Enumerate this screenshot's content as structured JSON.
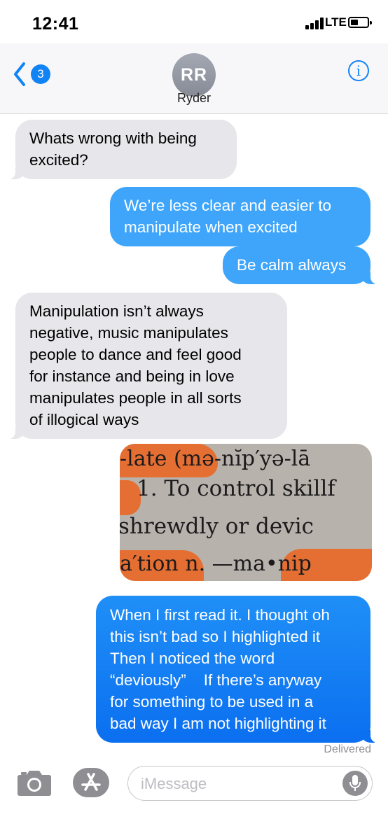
{
  "status_bar": {
    "time": "12:41",
    "network": "LTE"
  },
  "header": {
    "back_count": "3",
    "avatar_initials": "RR",
    "contact_name": "Ryder",
    "info_glyph": "i"
  },
  "messages": [
    {
      "direction": "incoming",
      "text_lines": [
        "Whats wrong with being",
        "excited?"
      ]
    },
    {
      "direction": "outgoing",
      "text_lines": [
        "We’re less clear and easier to",
        "manipulate when excited"
      ]
    },
    {
      "direction": "outgoing",
      "text_lines": [
        "Be calm always"
      ]
    },
    {
      "direction": "incoming",
      "text_lines": [
        "Manipulation isn’t always",
        "negative, music manipulates",
        "people to dance and feel good",
        "for instance and being in love",
        "manipulates people in all sorts",
        "of illogical ways"
      ]
    },
    {
      "direction": "outgoing",
      "type": "image",
      "image_text_lines": [
        "-late (mə-nĭp′yə-lā",
        "1. To control skillf",
        "shrewdly or devic",
        "a′tion n. —ma•nip"
      ]
    },
    {
      "direction": "outgoing",
      "text_lines": [
        "When I first read it. I thought oh",
        "this isn’t bad so I highlighted it",
        "Then I noticed the word",
        "“deviously”    If there’s anyway",
        "for something to be used in a",
        "bad way I am not highlighting it"
      ]
    }
  ],
  "delivered_label": "Delivered",
  "input_bar": {
    "camera_icon": "camera-icon",
    "appstore_icon": "app-store-icon",
    "placeholder": "iMessage",
    "mic_icon": "microphone-icon"
  },
  "colors": {
    "accent": "#1283f5",
    "incoming_bubble": "#e6e6eb",
    "outgoing_bubble": "#3ea5fb",
    "outgoing_last_bubble": "#0b6ff0",
    "highlighter": "#e56f32"
  }
}
